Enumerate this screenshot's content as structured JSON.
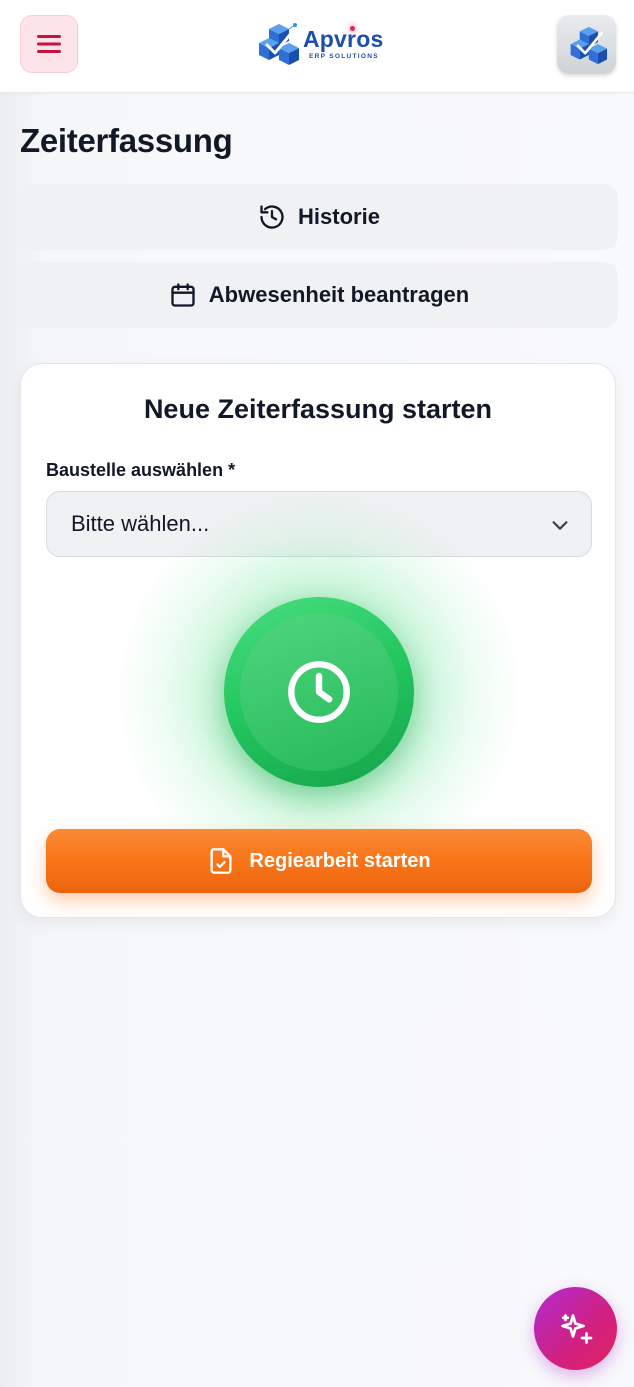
{
  "header": {
    "menu_icon": "hamburger-menu-icon",
    "logo_name": "Apvros",
    "logo_sub": "ERP SOLUTIONS",
    "avatar_icon": "company-logo-icon"
  },
  "page": {
    "title": "Zeiterfassung"
  },
  "actions": {
    "history_label": "Historie",
    "history_icon": "history-icon",
    "absence_label": "Abwesenheit beantragen",
    "absence_icon": "calendar-icon"
  },
  "card": {
    "title": "Neue Zeiterfassung starten",
    "site_label": "Baustelle auswählen *",
    "site_placeholder": "Bitte wählen...",
    "clock_icon": "clock-icon",
    "regie_label": "Regiearbeit starten",
    "regie_icon": "file-check-icon"
  },
  "fab": {
    "icon": "sparkles-icon"
  },
  "colors": {
    "menu_accent": "#c8143c",
    "brand_blue": "#1e4fa8",
    "clock_green": "#22c55e",
    "regie_orange": "#f97316",
    "fab_purple": "#b02bd0",
    "fab_pink": "#e0245e"
  }
}
